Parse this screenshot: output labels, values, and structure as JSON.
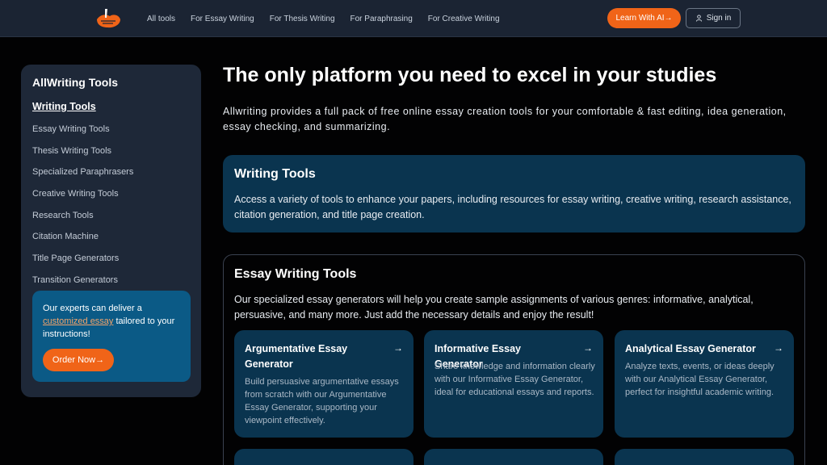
{
  "header": {
    "nav": [
      "All tools",
      "For Essay Writing",
      "For Thesis Writing",
      "For Paraphrasing",
      "For Creative Writing"
    ],
    "learn_label": "Learn With AI",
    "learn_arrow": "→",
    "signin_label": "Sign in",
    "accent": "#f06418"
  },
  "sidebar": {
    "title": "AllWriting Tools",
    "active": "Writing Tools",
    "items": [
      "Essay Writing Tools",
      "Thesis Writing Tools",
      "Specialized Paraphrasers",
      "Creative Writing Tools",
      "Research Tools",
      "Citation Machine",
      "Title Page Generators",
      "Transition Generators"
    ],
    "promo": {
      "before": "Our experts can deliver a ",
      "link": "customized essay",
      "after": " tailored to your instructions!",
      "button": "Order Now",
      "button_arrow": "→"
    }
  },
  "main": {
    "title": "The only platform you need to excel in your studies",
    "description": "Allwriting provides a full pack of free online essay creation tools for your comfortable & fast editing, idea generation, essay checking, and summarizing.",
    "writing_tools": {
      "title": "Writing Tools",
      "description": "Access a variety of tools to enhance your papers, including resources for essay writing, creative writing, research assistance, citation generation, and title page creation."
    },
    "essay_tools": {
      "title": "Essay Writing Tools",
      "description": "Our specialized essay generators will help you create sample assignments of various genres: informative, analytical, persuasive, and many more. Just add the necessary details and enjoy the result!",
      "cards": [
        {
          "title": "Argumentative Essay Generator",
          "description": "Build persuasive argumentative essays from scratch with our Argumentative Essay Generator, supporting your viewpoint effectively."
        },
        {
          "title": "Informative Essay Generator",
          "description": "Share knowledge and information clearly with our Informative Essay Generator, ideal for educational essays and reports."
        },
        {
          "title": "Analytical Essay Generator",
          "description": "Analyze texts, events, or ideas deeply with our Analytical Essay Generator, perfect for insightful academic writing."
        }
      ],
      "arrow": "→"
    }
  }
}
